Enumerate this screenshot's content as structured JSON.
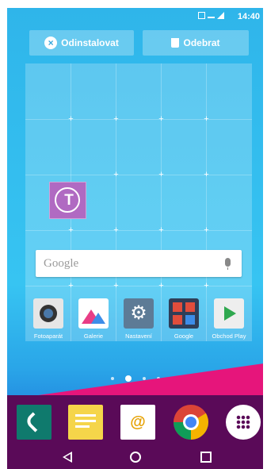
{
  "status_bar": {
    "time": "14:40",
    "icons": [
      "nfc-icon",
      "data-icon",
      "signal-icon",
      "battery-icon"
    ]
  },
  "actions": {
    "uninstall_label": "Odinstalovat",
    "remove_label": "Odebrat"
  },
  "widget": {
    "search_placeholder": "Google",
    "tmobile_letter": "T"
  },
  "apps": [
    {
      "label": "Fotoaparát",
      "icon": "camera-icon"
    },
    {
      "label": "Galerie",
      "icon": "gallery-icon"
    },
    {
      "label": "Nastavení",
      "icon": "settings-icon"
    },
    {
      "label": "Google",
      "icon": "google-folder-icon"
    },
    {
      "label": "Obchod Play",
      "icon": "play-store-icon"
    }
  ],
  "pages": {
    "count": 4,
    "active": 2
  },
  "dock": [
    "phone-icon",
    "messages-icon",
    "email-icon",
    "chrome-icon",
    "app-drawer-icon"
  ],
  "nav": [
    "back-icon",
    "home-icon",
    "recents-icon"
  ],
  "colors": {
    "accent": "#37c4f2",
    "dock": "#5a0a58",
    "pink": "#e6157b",
    "tmobile": "#b06ac2"
  }
}
